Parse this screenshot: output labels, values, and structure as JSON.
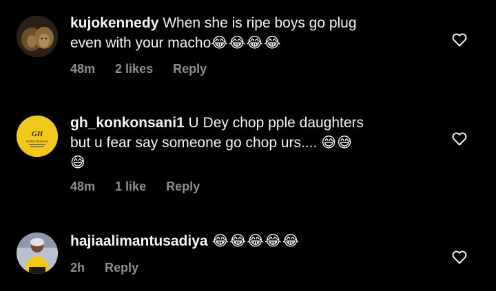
{
  "comments": [
    {
      "username": "kujokennedy",
      "text_line1": "When she is ripe boys go plug",
      "text_line2": "even with your macho",
      "emojis_line2": "😂😂😂😂",
      "time": "48m",
      "likes": "2 likes",
      "reply": "Reply",
      "avatar_icon": "lion-avatar"
    },
    {
      "username": "gh_konkonsani1",
      "text_line1": "U Dey chop pple daughters",
      "text_line2": "but u fear say someone go chop urs....",
      "emojis_line2": "😅😅",
      "emojis_line3": "😅",
      "time": "48m",
      "likes": "1 like",
      "reply": "Reply",
      "avatar_label": "GH",
      "avatar_sub": "KONKONSANI",
      "avatar_icon": "gh-konkonsani-logo"
    },
    {
      "username": "hajiaalimantusadiya",
      "emojis_line1": "😂😂😂😂😂",
      "time": "2h",
      "reply": "Reply",
      "avatar_icon": "woman-avatar"
    }
  ],
  "colors": {
    "background": "#000000",
    "text": "#f5f5f5",
    "meta": "#8e8e8e",
    "avatar_yellow": "#f2c81e"
  },
  "icons": {
    "like": "heart-outline-icon"
  }
}
